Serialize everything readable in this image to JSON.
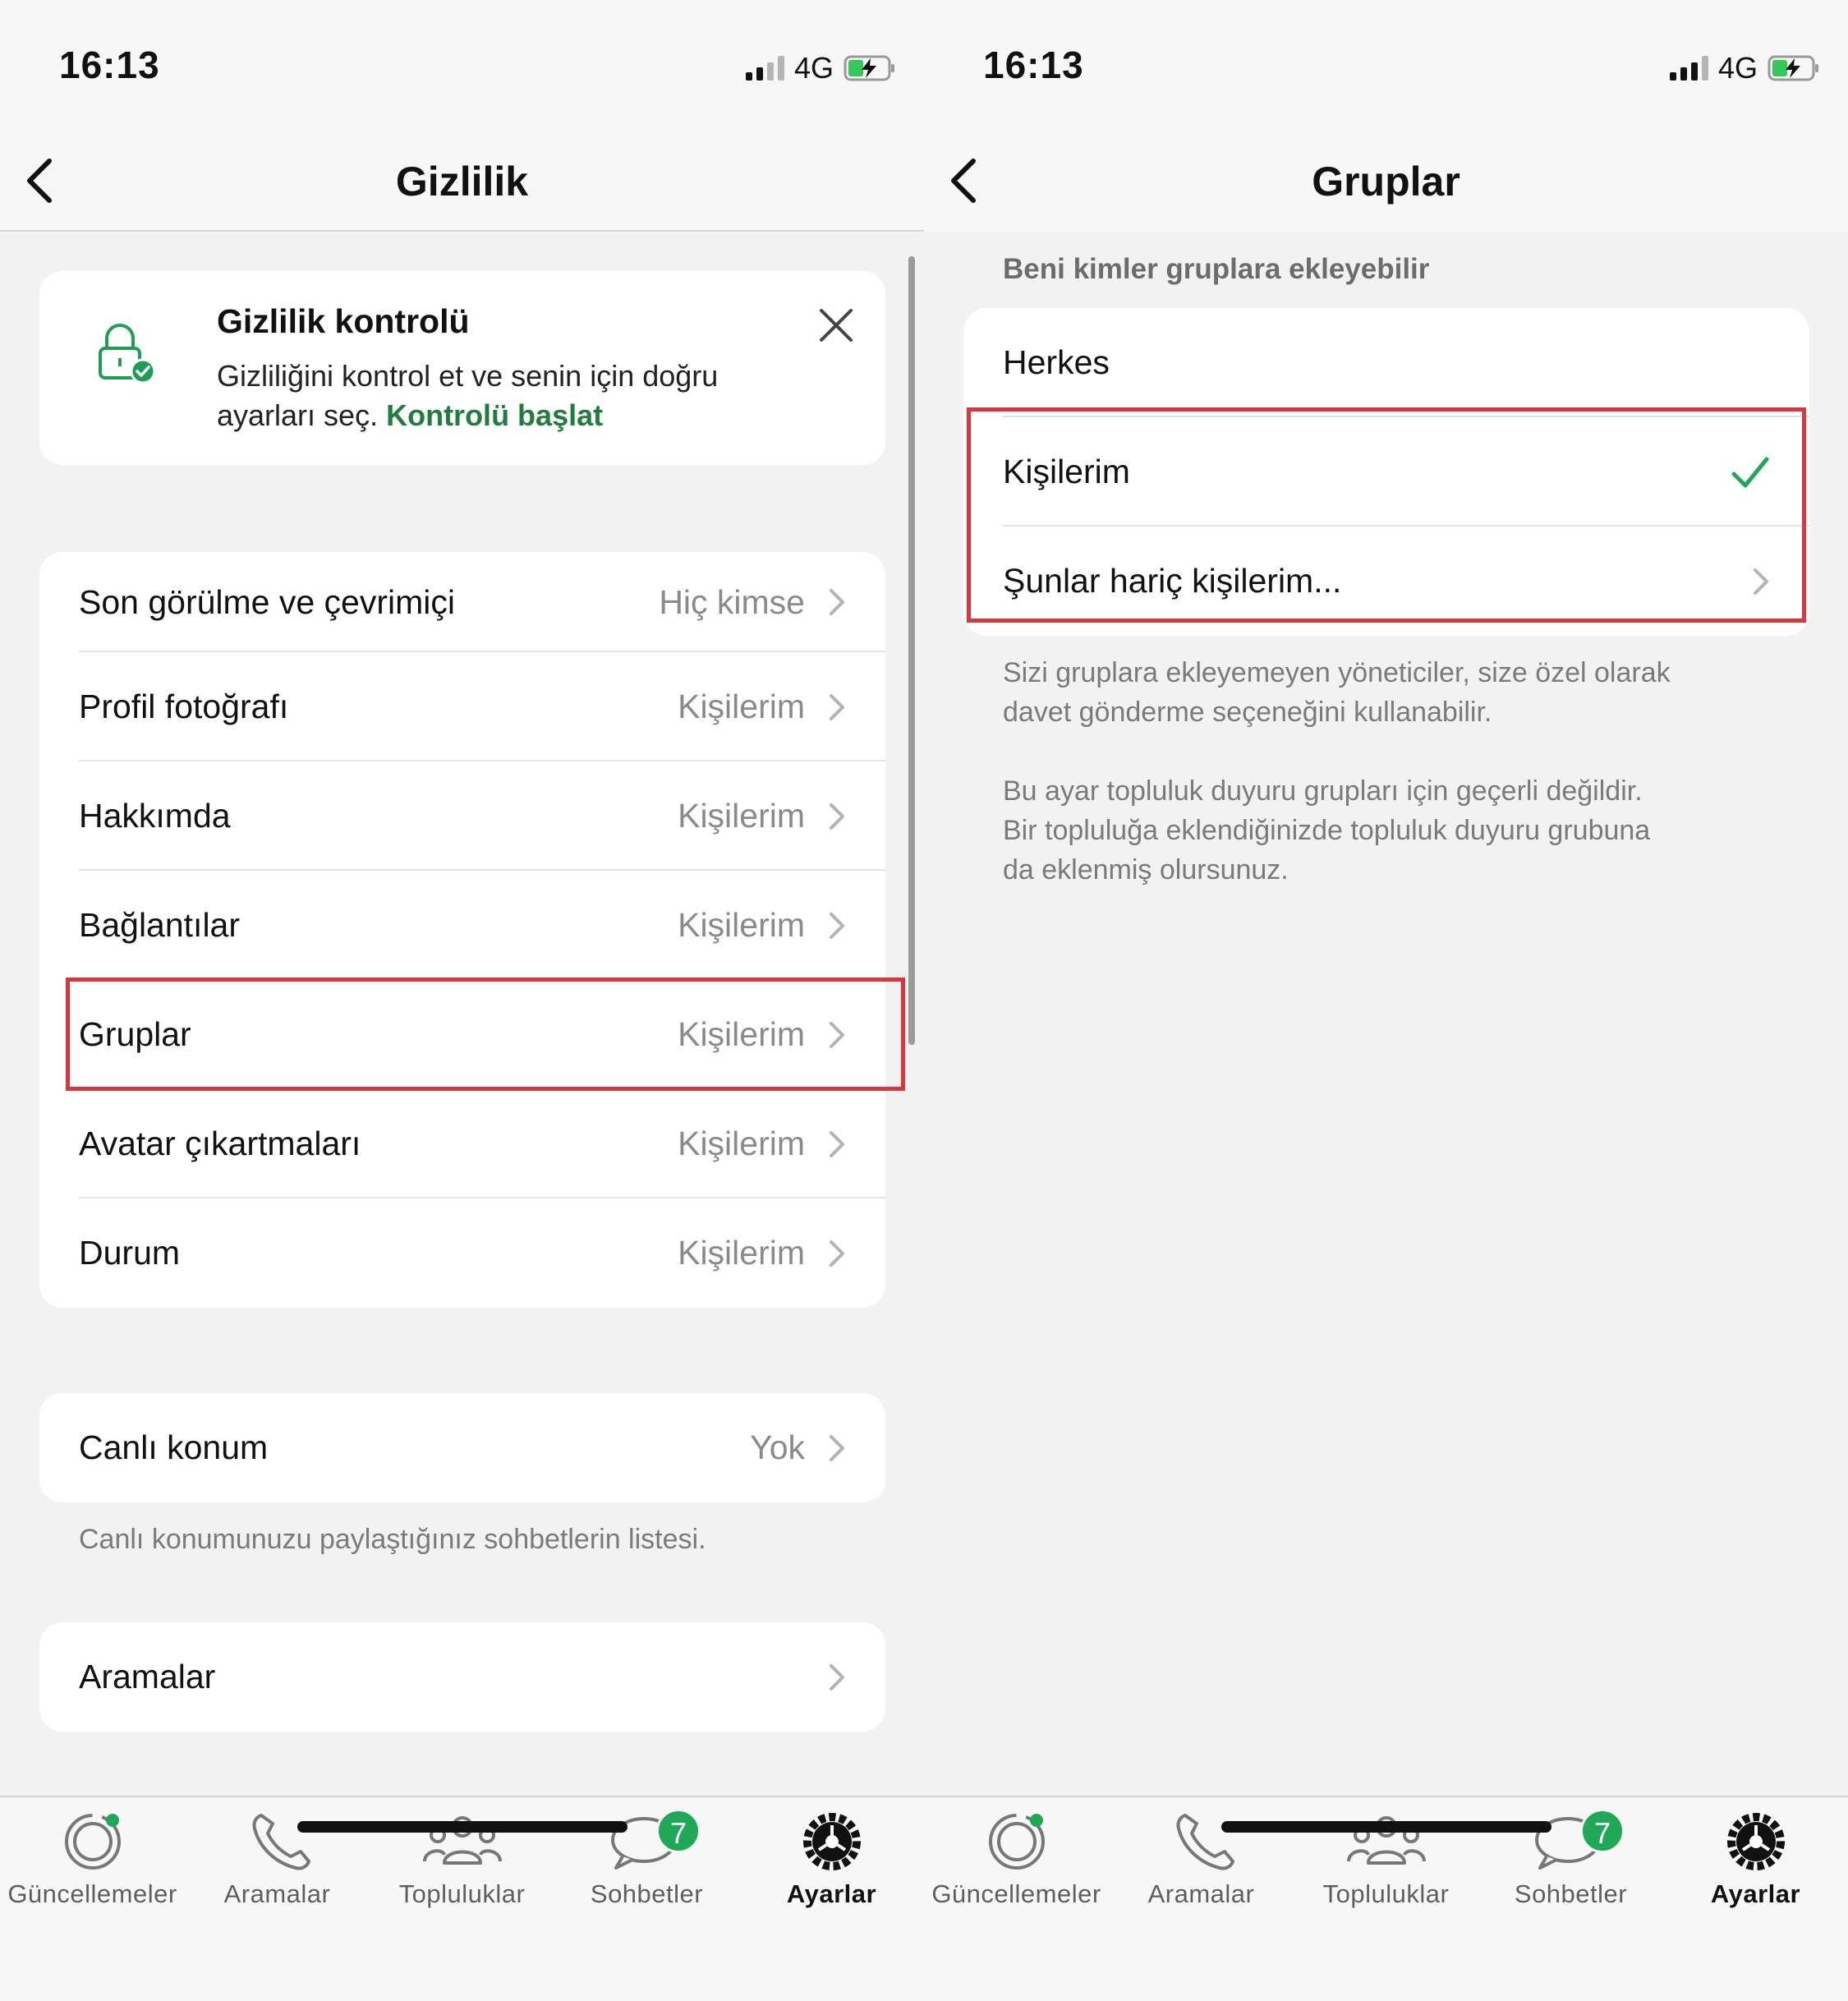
{
  "left": {
    "status": {
      "time": "16:13",
      "network": "4G"
    },
    "nav_title": "Gizlilik",
    "privacy_check": {
      "title": "Gizlilik kontrolü",
      "text": "Gizliliğini kontrol et ve senin için doğru ayarları seç.",
      "link": "Kontrolü başlat"
    },
    "settings": [
      {
        "label": "Son görülme ve çevrimiçi",
        "value": "Hiç kimse"
      },
      {
        "label": "Profil fotoğrafı",
        "value": "Kişilerim"
      },
      {
        "label": "Hakkımda",
        "value": "Kişilerim"
      },
      {
        "label": "Bağlantılar",
        "value": "Kişilerim"
      },
      {
        "label": "Gruplar",
        "value": "Kişilerim"
      },
      {
        "label": "Avatar çıkartmaları",
        "value": "Kişilerim"
      },
      {
        "label": "Durum",
        "value": "Kişilerim"
      }
    ],
    "live_location": {
      "label": "Canlı konum",
      "value": "Yok",
      "footnote": "Canlı konumunuzu paylaştığınız sohbetlerin listesi."
    },
    "calls_row": {
      "label": "Aramalar"
    }
  },
  "right": {
    "status": {
      "time": "16:13",
      "network": "4G"
    },
    "nav_title": "Gruplar",
    "section_header": "Beni kimler gruplara ekleyebilir",
    "options": [
      {
        "label": "Herkes",
        "selected": false
      },
      {
        "label": "Kişilerim",
        "selected": true
      },
      {
        "label": "Şunlar hariç kişilerim...",
        "selected": false
      }
    ],
    "note1_line1": "Sizi gruplara ekleyemeyen yöneticiler, size özel olarak",
    "note1_line2": "davet gönderme seçeneğini kullanabilir.",
    "note2_line1": "Bu ayar topluluk duyuru grupları için geçerli değildir.",
    "note2_line2": "Bir topluluğa eklendiğinizde topluluk duyuru grubuna",
    "note2_line3": "da eklenmiş olursunuz."
  },
  "tabbar": {
    "tabs": [
      {
        "label": "Güncellemeler",
        "icon": "updates-icon"
      },
      {
        "label": "Aramalar",
        "icon": "phone-icon"
      },
      {
        "label": "Topluluklar",
        "icon": "communities-icon"
      },
      {
        "label": "Sohbetler",
        "icon": "chats-icon",
        "badge": "7"
      },
      {
        "label": "Ayarlar",
        "icon": "settings-gear-icon",
        "active": true
      }
    ]
  },
  "colors": {
    "accent": "#1f7d3e",
    "badge": "#1fa855",
    "highlight": "#d9363e"
  }
}
